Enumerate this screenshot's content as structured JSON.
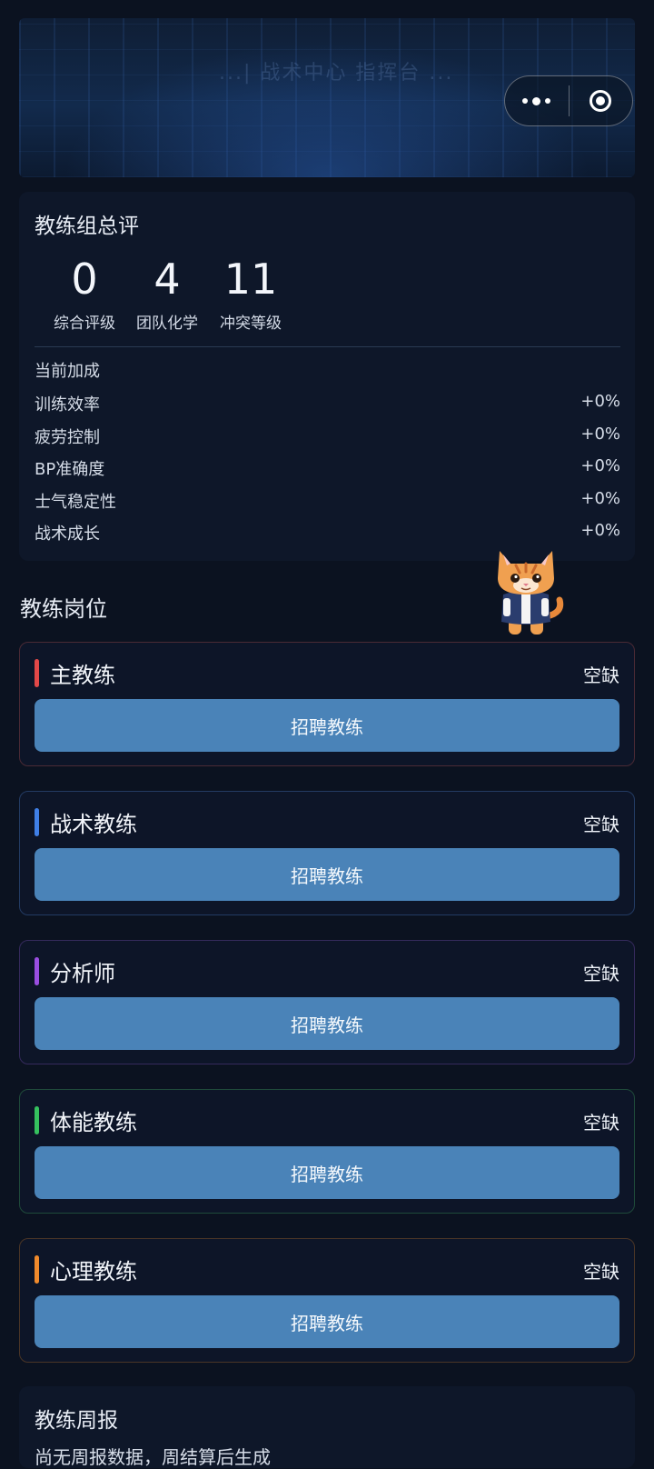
{
  "header": {
    "banner_title": "...| 战术中心 指挥台 ..."
  },
  "summary": {
    "title": "教练组总评",
    "stats": [
      {
        "value": "0",
        "label": "综合评级"
      },
      {
        "value": "4",
        "label": "团队化学"
      },
      {
        "value": "11",
        "label": "冲突等级"
      }
    ],
    "bonus_heading": "当前加成",
    "bonuses": [
      {
        "label": "训练效率",
        "value": "+0%"
      },
      {
        "label": "疲劳控制",
        "value": "+0%"
      },
      {
        "label": "BP准确度",
        "value": "+0%"
      },
      {
        "label": "士气稳定性",
        "value": "+0%"
      },
      {
        "label": "战术成长",
        "value": "+0%"
      }
    ]
  },
  "positions": {
    "title": "教练岗位",
    "items": [
      {
        "role": "主教练",
        "status": "空缺",
        "button": "招聘教练",
        "accent": "#e24848",
        "border": "#4a2a35"
      },
      {
        "role": "战术教练",
        "status": "空缺",
        "button": "招聘教练",
        "accent": "#3f7fe6",
        "border": "#233b63"
      },
      {
        "role": "分析师",
        "status": "空缺",
        "button": "招聘教练",
        "accent": "#9a4ee0",
        "border": "#352a5c"
      },
      {
        "role": "体能教练",
        "status": "空缺",
        "button": "招聘教练",
        "accent": "#35c05e",
        "border": "#1f4a3a"
      },
      {
        "role": "心理教练",
        "status": "空缺",
        "button": "招聘教练",
        "accent": "#f08a2c",
        "border": "#4a3526"
      }
    ]
  },
  "weekly": {
    "title": "教练周报",
    "desc": "尚无周报数据，周结算后生成"
  },
  "icons": {
    "capsule_more": "more-dots-icon",
    "capsule_close": "target-close-icon",
    "mascot": "cat-mascot-icon"
  }
}
